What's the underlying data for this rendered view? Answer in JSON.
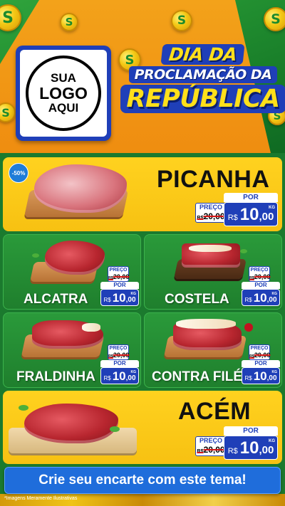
{
  "header": {
    "logo": {
      "line1": "SUA",
      "line2": "LOGO",
      "line3": "AQUI"
    },
    "title": {
      "line1": "DIA DA",
      "line2": "PROCLAMAÇÃO DA",
      "line3": "REPÚBLICA"
    }
  },
  "labels": {
    "preco": "PREÇO",
    "por": "POR",
    "currency": "R$",
    "unit": "KG"
  },
  "products": [
    {
      "name": "PICANHA",
      "discount": "-50%",
      "old_price": "20,00",
      "price_int": "10",
      "price_dec": ",00"
    },
    {
      "name": "ALCATRA",
      "old_price": "20,00",
      "price_int": "10",
      "price_dec": ",00"
    },
    {
      "name": "COSTELA",
      "old_price": "20,00",
      "price_int": "10",
      "price_dec": ",00"
    },
    {
      "name": "FRALDINHA",
      "old_price": "20,00",
      "price_int": "10",
      "price_dec": ",00"
    },
    {
      "name": "CONTRA FILÉ",
      "old_price": "20,00",
      "price_int": "10",
      "price_dec": ",00"
    },
    {
      "name": "ACÉM",
      "old_price": "20,00",
      "price_int": "10",
      "price_dec": ",00"
    }
  ],
  "cta": {
    "label": "Crie seu encarte com este tema!"
  },
  "disclaimer": "*Imagens Meramente Ilustrativas",
  "colors": {
    "green": "#1f8a2e",
    "yellow": "#ffd21f",
    "blue": "#1f3fb8",
    "orange": "#ef8d10"
  }
}
